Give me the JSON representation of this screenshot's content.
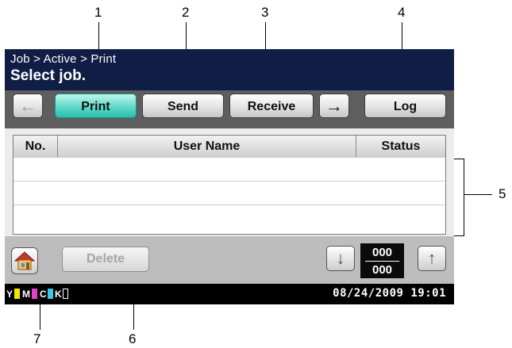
{
  "callouts": [
    "1",
    "2",
    "3",
    "4",
    "5",
    "6",
    "7"
  ],
  "header": {
    "breadcrumb": "Job > Active > Print",
    "prompt": "Select job."
  },
  "tabs": {
    "back_arrow": "←",
    "print": "Print",
    "send": "Send",
    "receive": "Receive",
    "forward_arrow": "→",
    "log": "Log",
    "active": "print"
  },
  "table": {
    "columns": [
      "No.",
      "User Name",
      "Status"
    ],
    "rows": []
  },
  "bottom": {
    "delete_label": "Delete",
    "down_arrow": "↓",
    "up_arrow": "↑",
    "current_page": "000",
    "total_pages": "000"
  },
  "status": {
    "toner": [
      {
        "label": "Y",
        "color": "#f2e600"
      },
      {
        "label": "M",
        "color": "#e640c8"
      },
      {
        "label": "C",
        "color": "#3cc8e6"
      },
      {
        "label": "K",
        "color": "#000000"
      }
    ],
    "datetime": "08/24/2009 19:01"
  },
  "icons": {
    "home": "home-icon"
  }
}
